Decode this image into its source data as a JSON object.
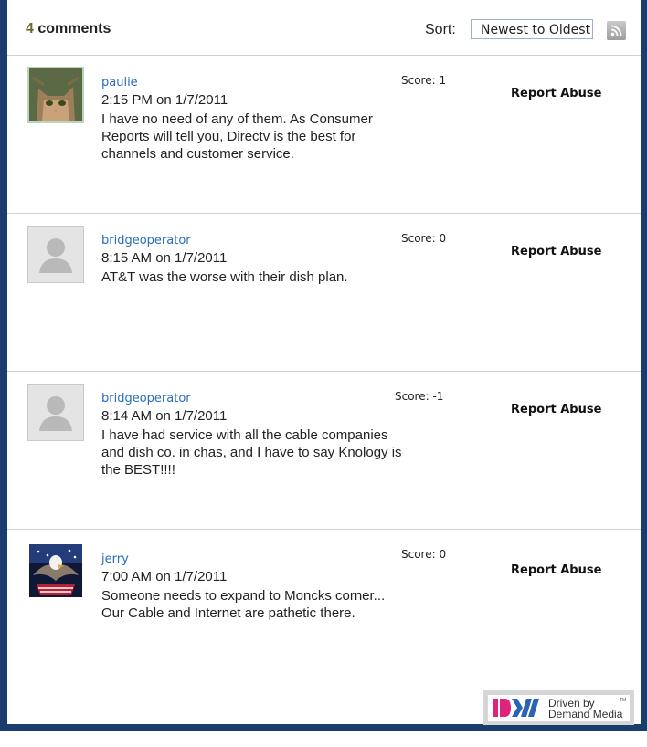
{
  "header": {
    "count_number": "4",
    "count_word": "comments",
    "sort_label": "Sort:",
    "sort_selected": "Newest to Oldest",
    "rss_icon": "rss-feed-icon"
  },
  "comments": [
    {
      "username": "paulie",
      "timestamp": "2:15 PM on 1/7/2011",
      "lines": [
        "I have no need of any of them. As Consumer",
        "Reports will tell you, Directv is the best for",
        "channels and customer service."
      ],
      "score": "Score: 1",
      "report": "Report Abuse",
      "avatar": "cat-photo-avatar"
    },
    {
      "username": "bridgeoperator",
      "timestamp": "8:15 AM on 1/7/2011",
      "lines": [
        "AT&T was the worse with their dish plan."
      ],
      "score": "Score: 0",
      "report": "Report Abuse",
      "avatar": "default-user-avatar"
    },
    {
      "username": "bridgeoperator",
      "timestamp": "8:14 AM on 1/7/2011",
      "lines": [
        "I have had service with all the cable companies",
        "and dish co. in chas, and I have to say Knology is",
        "the BEST!!!!"
      ],
      "score": "Score: -1",
      "report": "Report Abuse",
      "avatar": "default-user-avatar"
    },
    {
      "username": "jerry",
      "timestamp": "7:00 AM on 1/7/2011",
      "lines": [
        "Someone needs to expand to Moncks corner...",
        "Our Cable and Internet are pathetic there."
      ],
      "score": "Score: 0",
      "report": "Report Abuse",
      "avatar": "eagle-photo-avatar"
    }
  ],
  "footer": {
    "logo_line1": "Driven by",
    "logo_line2": "Demand Media",
    "logo_tm": "TM",
    "brand_colors": {
      "magenta": "#e0237a",
      "blue": "#2a64b3",
      "gray": "#d6d6d6"
    }
  },
  "colors": {
    "frame": "#1b3d6e",
    "username": "#2a6cc0",
    "count_number": "#6b6a2f"
  }
}
